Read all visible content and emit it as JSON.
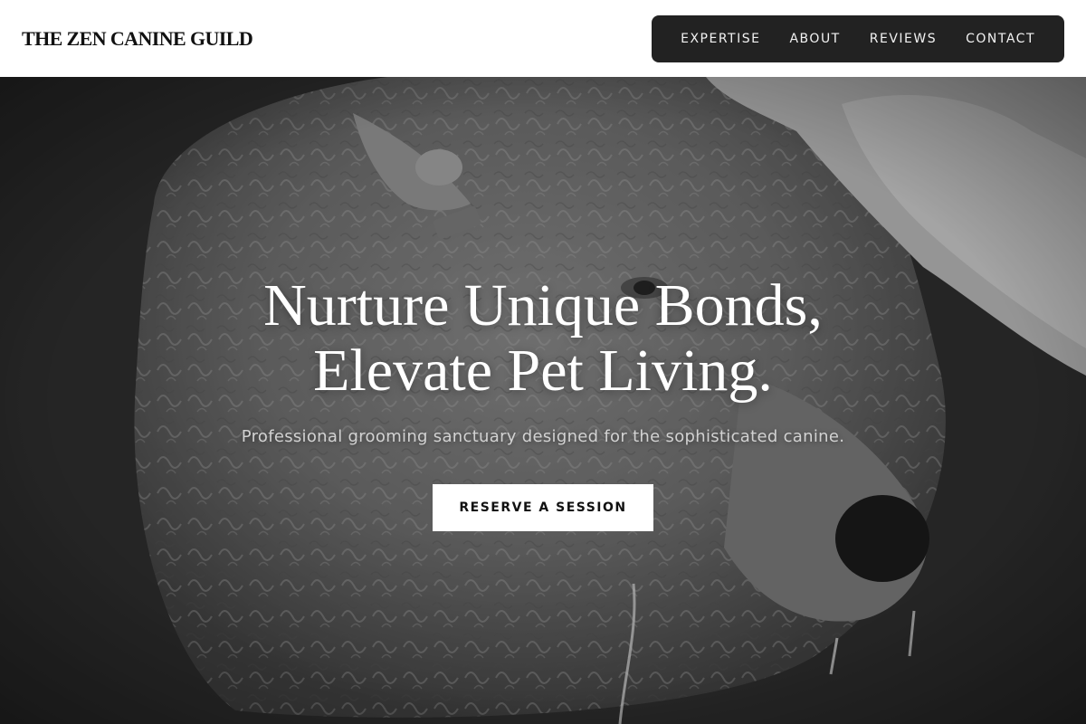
{
  "brand": {
    "name": "THE ZEN CANINE GUILD"
  },
  "nav": {
    "items": [
      {
        "label": "EXPERTISE"
      },
      {
        "label": "ABOUT"
      },
      {
        "label": "REVIEWS"
      },
      {
        "label": "CONTACT"
      }
    ]
  },
  "hero": {
    "title_line1": "Nurture Unique Bonds,",
    "title_line2": "Elevate Pet Living.",
    "subtitle": "Professional grooming sanctuary designed for the sophisticated canine.",
    "cta_label": "RESERVE A SESSION",
    "image_subject": "black-and-white photo of a curly-fleeced sheep with ear tags being touched by a hand"
  },
  "colors": {
    "header_bg": "#ffffff",
    "nav_bg": "#222222",
    "nav_text": "#f2f2f2",
    "hero_text": "#ffffff",
    "cta_bg": "#ffffff",
    "cta_text": "#111111"
  }
}
